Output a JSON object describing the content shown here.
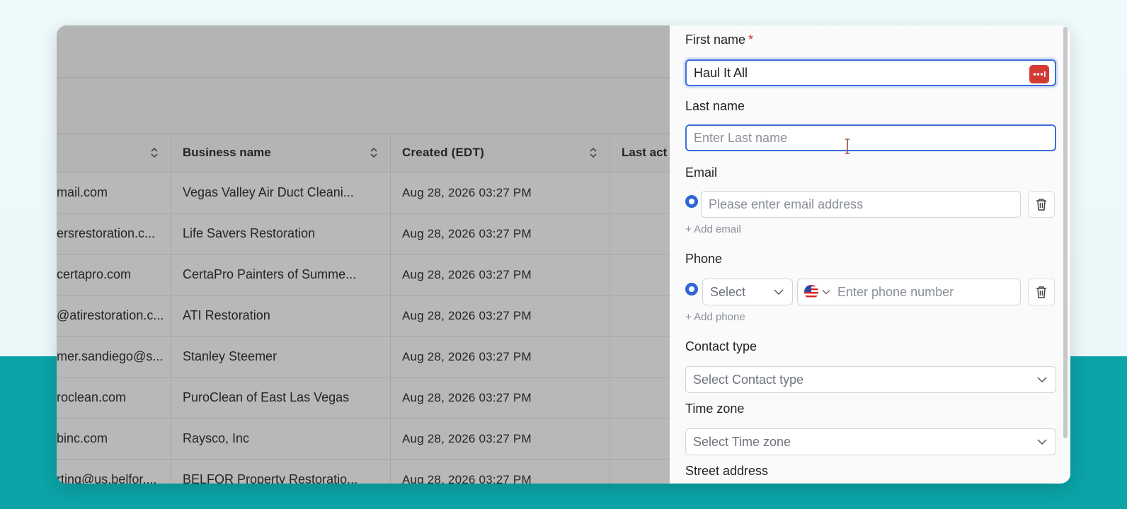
{
  "table": {
    "columns": [
      "",
      "Business name",
      "Created (EDT)",
      "Last act"
    ],
    "rows": [
      {
        "email": "mail.com",
        "business": "Vegas Valley Air Duct Cleani...",
        "created": "Aug 28, 2026 03:27 PM"
      },
      {
        "email": "ersrestoration.c...",
        "business": "Life Savers Restoration",
        "created": "Aug 28, 2026 03:27 PM"
      },
      {
        "email": "certapro.com",
        "business": "CertaPro Painters of Summe...",
        "created": "Aug 28, 2026 03:27 PM"
      },
      {
        "email": "@atirestoration.c...",
        "business": "ATI Restoration",
        "created": "Aug 28, 2026 03:27 PM"
      },
      {
        "email": "mer.sandiego@s...",
        "business": "Stanley Steemer",
        "created": "Aug 28, 2026 03:27 PM"
      },
      {
        "email": "roclean.com",
        "business": "PuroClean of East Las Vegas",
        "created": "Aug 28, 2026 03:27 PM"
      },
      {
        "email": "binc.com",
        "business": "Raysco, Inc",
        "created": "Aug 28, 2026 03:27 PM"
      },
      {
        "email": "rting@us.belfor....",
        "business": "BELFOR Property Restoratio...",
        "created": "Aug 28, 2026 03:27 PM"
      }
    ]
  },
  "form": {
    "first_name_label": "First name",
    "required_mark": "*",
    "first_name_value": "Haul It All",
    "last_name_label": "Last name",
    "last_name_placeholder": "Enter Last name",
    "email_label": "Email",
    "email_placeholder": "Please enter email address",
    "add_email": "+ Add email",
    "phone_label": "Phone",
    "phone_type_placeholder": "Select",
    "phone_placeholder": "Enter phone number",
    "add_phone": "+ Add phone",
    "contact_type_label": "Contact type",
    "contact_type_placeholder": "Select Contact type",
    "time_zone_label": "Time zone",
    "time_zone_placeholder": "Select Time zone",
    "street_address_label": "Street address"
  },
  "colors": {
    "accent": "#2f66d6",
    "teal": "#0ba3a6",
    "password_badge": "#d33a34",
    "required": "#d0342c"
  },
  "icons": [
    "sort-icon",
    "password-manager-icon",
    "trash-icon",
    "chevron-down-icon",
    "us-flag-icon",
    "text-cursor-icon"
  ]
}
